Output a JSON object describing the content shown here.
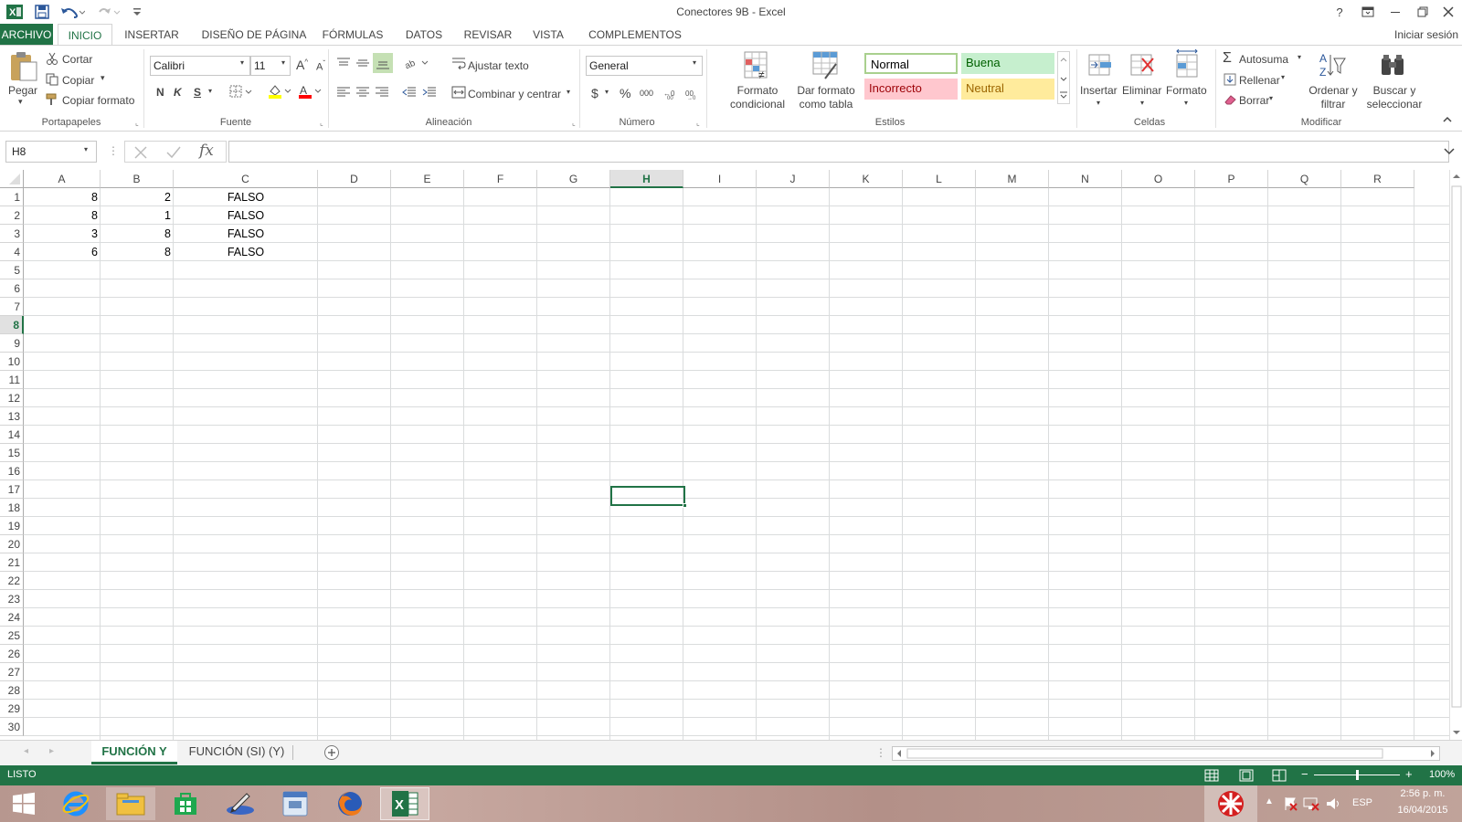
{
  "window": {
    "title": "Conectores 9B - Excel",
    "help": "?",
    "restore_ribbon": "⧉",
    "minimize": "—",
    "maximize": "❐",
    "close": "✕"
  },
  "tabs": [
    "ARCHIVO",
    "INICIO",
    "INSERTAR",
    "DISEÑO DE PÁGINA",
    "FÓRMULAS",
    "DATOS",
    "REVISAR",
    "VISTA",
    "COMPLEMENTOS"
  ],
  "signin": "Iniciar sesión",
  "ribbon": {
    "clipboard": {
      "paste": "Pegar",
      "cut": "Cortar",
      "copy": "Copiar",
      "format_painter": "Copiar formato",
      "label": "Portapapeles"
    },
    "font": {
      "name": "Calibri",
      "size": "11",
      "bold": "N",
      "italic": "K",
      "underline": "S",
      "label": "Fuente"
    },
    "alignment": {
      "wrap": "Ajustar texto",
      "merge": "Combinar y centrar",
      "label": "Alineación"
    },
    "number": {
      "format": "General",
      "currency": "$",
      "percent": "%",
      "thousands": "000",
      "label": "Número"
    },
    "styles": {
      "conditional": [
        "Formato",
        "condicional"
      ],
      "as_table": [
        "Dar formato",
        "como tabla"
      ],
      "normal": "Normal",
      "good": "Buena",
      "bad": "Incorrecto",
      "neutral": "Neutral",
      "label": "Estilos"
    },
    "cells": {
      "insert": "Insertar",
      "delete": "Eliminar",
      "format": "Formato",
      "label": "Celdas"
    },
    "editing": {
      "autosum": "Autosuma",
      "fill": "Rellenar",
      "clear": "Borrar",
      "sort": [
        "Ordenar y",
        "filtrar"
      ],
      "find": [
        "Buscar y",
        "seleccionar"
      ],
      "label": "Modificar"
    }
  },
  "formula_bar": {
    "name_box": "H8",
    "fx": "fx",
    "value": ""
  },
  "columns": [
    "A",
    "B",
    "C",
    "D",
    "E",
    "F",
    "G",
    "H",
    "I",
    "J",
    "K",
    "L",
    "M",
    "N",
    "O",
    "P",
    "Q",
    "R"
  ],
  "rows": [
    "1",
    "2",
    "3",
    "4",
    "5",
    "6",
    "7",
    "8",
    "9",
    "10",
    "11",
    "12",
    "13",
    "14",
    "15",
    "16",
    "17",
    "18",
    "19",
    "20",
    "21",
    "22",
    "23",
    "24",
    "25",
    "26",
    "27",
    "28",
    "29",
    "30"
  ],
  "cells": [
    {
      "a": "8",
      "b": "2",
      "c": "FALSO"
    },
    {
      "a": "8",
      "b": "1",
      "c": "FALSO"
    },
    {
      "a": "3",
      "b": "8",
      "c": "FALSO"
    },
    {
      "a": "6",
      "b": "8",
      "c": "FALSO"
    }
  ],
  "selected_cell": "H8",
  "sheets": [
    "FUNCIÓN Y",
    "FUNCIÓN (SI) (Y)"
  ],
  "active_sheet": "FUNCIÓN Y",
  "status": {
    "mode": "LISTO",
    "zoom": "100%"
  },
  "taskbar": {
    "lang": "ESP",
    "time": "2:56 p. m.",
    "date": "16/04/2015"
  },
  "colors": {
    "accent": "#217346",
    "good_bg": "#c6efce",
    "good_fg": "#006100",
    "bad_bg": "#ffc7ce",
    "bad_fg": "#9c0006",
    "neutral_bg": "#ffeb9c",
    "neutral_fg": "#9c6500"
  }
}
